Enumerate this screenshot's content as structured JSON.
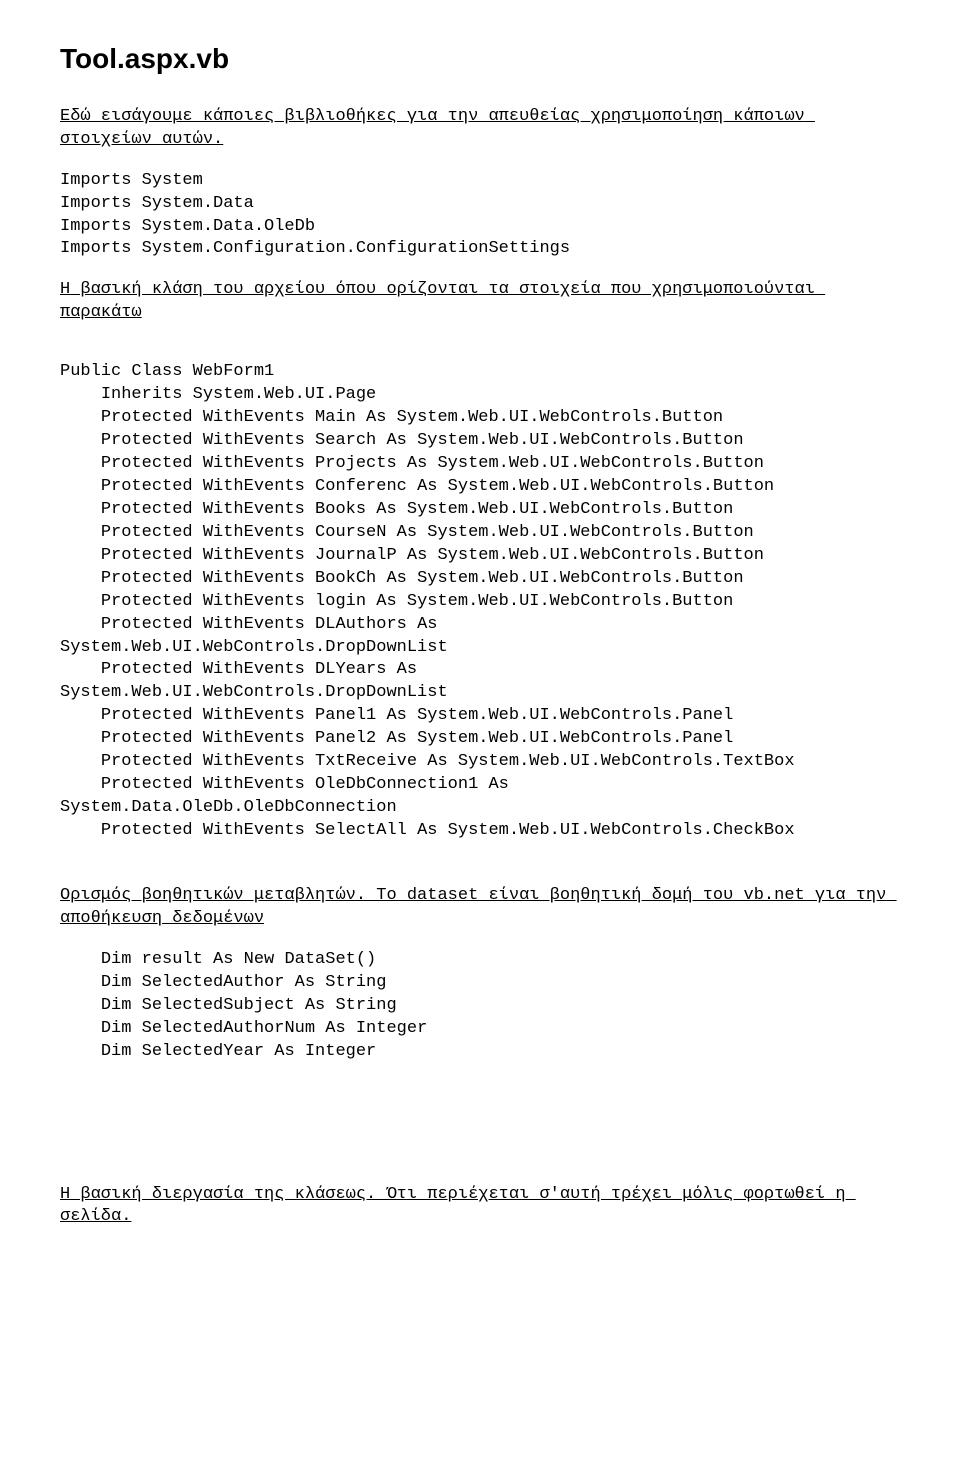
{
  "title": "Tool.aspx.vb",
  "annot1": "Εδώ εισάγουμε κάποιες βιβλιοθήκες για την απευθείας χρησιμοποίηση κάποιων στοιχείων αυτών.",
  "imports": "Imports System\nImports System.Data\nImports System.Data.OleDb\nImports System.Configuration.ConfigurationSettings",
  "annot2": "Η βασική κλάση του αρχείου όπου ορίζονται τα στοιχεία που χρησιμοποιούνται παρακάτω",
  "classBlock": "Public Class WebForm1\n    Inherits System.Web.UI.Page\n    Protected WithEvents Main As System.Web.UI.WebControls.Button\n    Protected WithEvents Search As System.Web.UI.WebControls.Button\n    Protected WithEvents Projects As System.Web.UI.WebControls.Button\n    Protected WithEvents Conferenc As System.Web.UI.WebControls.Button\n    Protected WithEvents Books As System.Web.UI.WebControls.Button\n    Protected WithEvents CourseN As System.Web.UI.WebControls.Button\n    Protected WithEvents JournalP As System.Web.UI.WebControls.Button\n    Protected WithEvents BookCh As System.Web.UI.WebControls.Button\n    Protected WithEvents login As System.Web.UI.WebControls.Button\n    Protected WithEvents DLAuthors As\nSystem.Web.UI.WebControls.DropDownList\n    Protected WithEvents DLYears As\nSystem.Web.UI.WebControls.DropDownList\n    Protected WithEvents Panel1 As System.Web.UI.WebControls.Panel\n    Protected WithEvents Panel2 As System.Web.UI.WebControls.Panel\n    Protected WithEvents TxtReceive As System.Web.UI.WebControls.TextBox\n    Protected WithEvents OleDbConnection1 As\nSystem.Data.OleDb.OleDbConnection\n    Protected WithEvents SelectAll As System.Web.UI.WebControls.CheckBox",
  "annot3": "Ορισμός βοηθητικών μεταβλητών. Το dataset είναι βοηθητική δομή του vb.net για την αποθήκευση δεδομένων",
  "dimBlock": "    Dim result As New DataSet()\n    Dim SelectedAuthor As String\n    Dim SelectedSubject As String\n    Dim SelectedAuthorNum As Integer\n    Dim SelectedYear As Integer",
  "annot4": "Η βασική διεργασία της κλάσεως. Ότι περιέχεται σ'αυτή τρέχει μόλις φορτωθεί η σελίδα."
}
